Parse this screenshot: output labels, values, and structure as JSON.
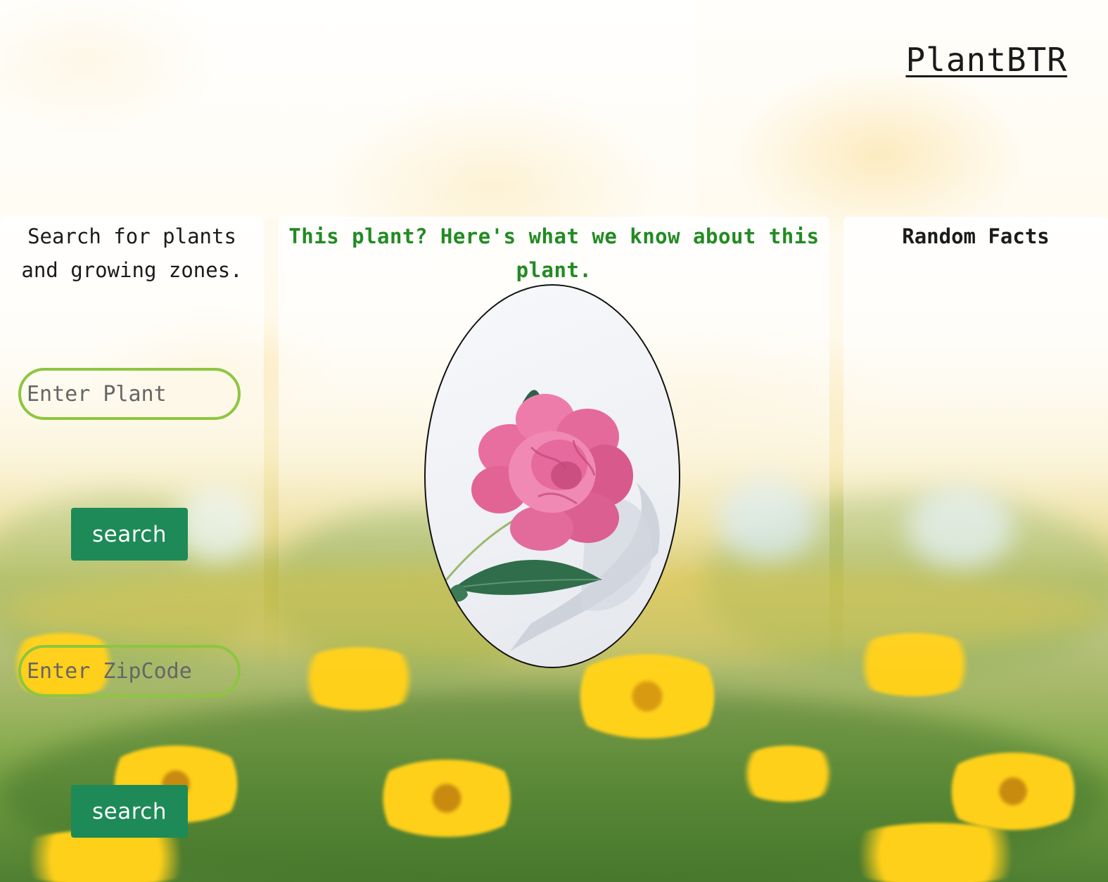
{
  "header": {
    "title": "PlantBTR"
  },
  "left_panel": {
    "heading": "Search for plants and growing zones.",
    "plant_input_placeholder": "Enter Plant",
    "plant_search_label": "search",
    "zip_input_placeholder": "Enter ZipCode",
    "zip_search_label": "search"
  },
  "middle_panel": {
    "heading": "This plant? Here's what we know about this plant.",
    "image_icon": "pink-peony-flower"
  },
  "right_panel": {
    "heading": "Random Facts"
  },
  "colors": {
    "accent_green": "#1d8a57",
    "heading_green": "#228b22",
    "input_border": "#8dc63f"
  }
}
